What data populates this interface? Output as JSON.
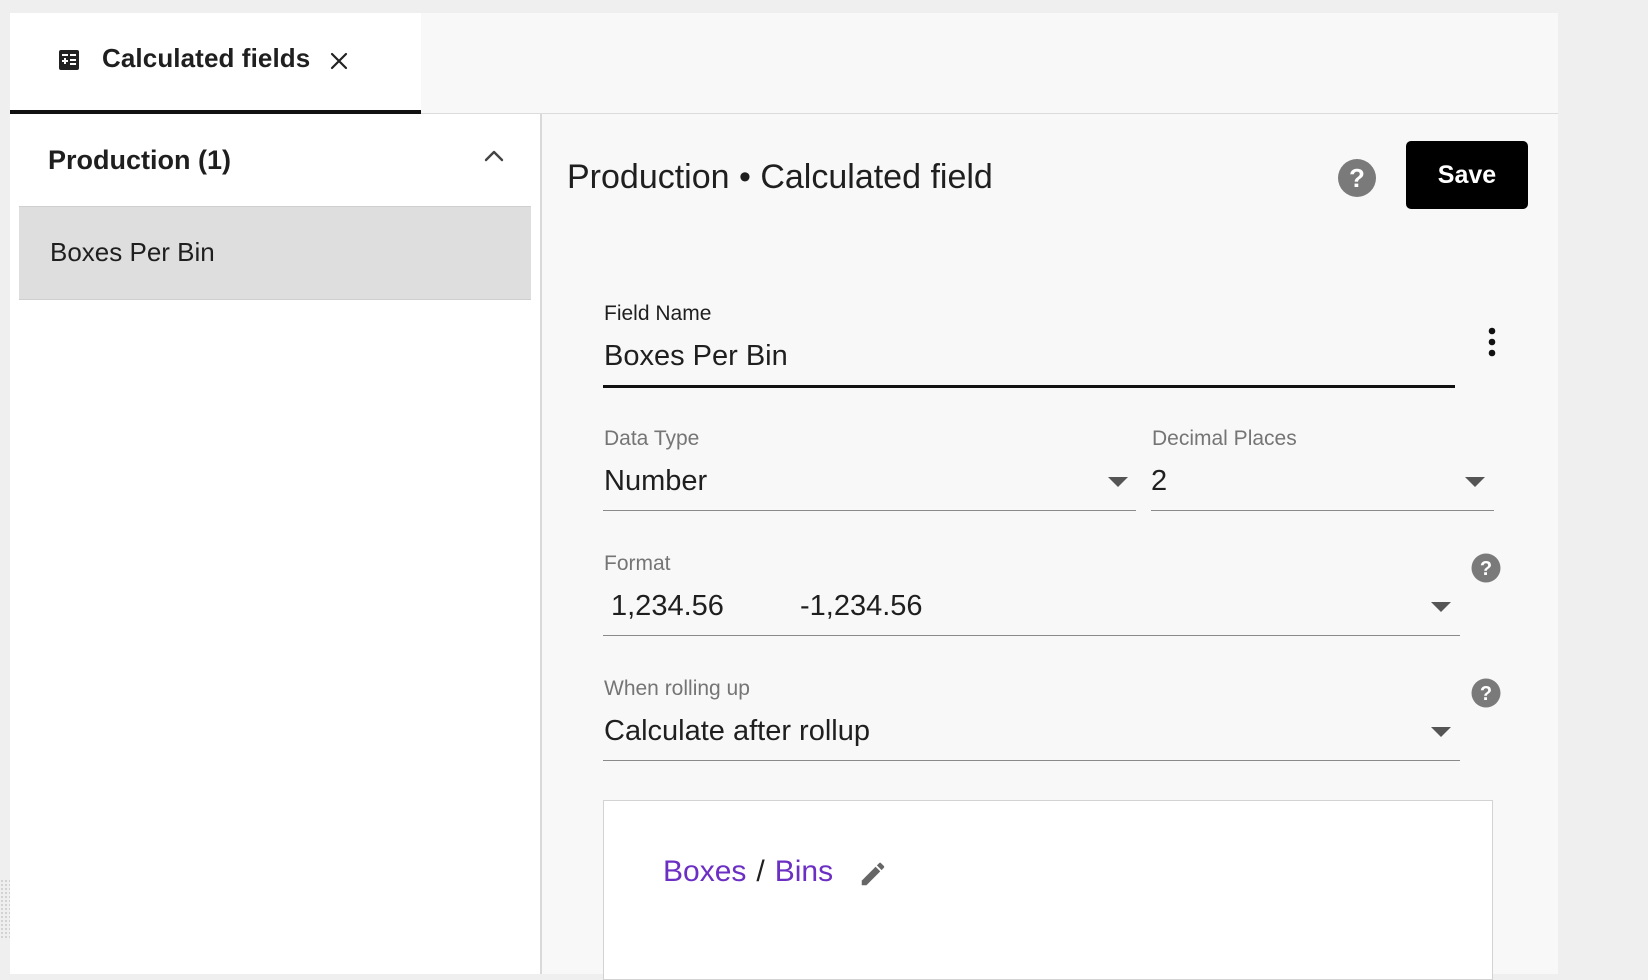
{
  "tab": {
    "icon": "calculator-icon",
    "label": "Calculated fields",
    "close_icon": "close-icon"
  },
  "sidebar": {
    "group_title": "Production (1)",
    "group_icon": "chevron-up-icon",
    "items": [
      {
        "label": "Boxes Per Bin",
        "selected": true
      }
    ]
  },
  "editor": {
    "title": "Production • Calculated field",
    "help_icon": "help-icon",
    "save_label": "Save",
    "field_name": {
      "label": "Field Name",
      "value": "Boxes Per Bin"
    },
    "data_type": {
      "label": "Data Type",
      "value": "Number"
    },
    "decimal_places": {
      "label": "Decimal Places",
      "value": "2"
    },
    "format": {
      "label": "Format",
      "positive_example": "1,234.56",
      "negative_example": "-1,234.56"
    },
    "rollup": {
      "label": "When rolling up",
      "value": "Calculate after rollup"
    },
    "formula": {
      "left": "Boxes",
      "operator": "/",
      "right": "Bins",
      "edit_icon": "pencil-icon"
    }
  },
  "colors": {
    "accent_black": "#000000",
    "formula_token": "#6c2fc4",
    "selected_row": "#dedede"
  }
}
